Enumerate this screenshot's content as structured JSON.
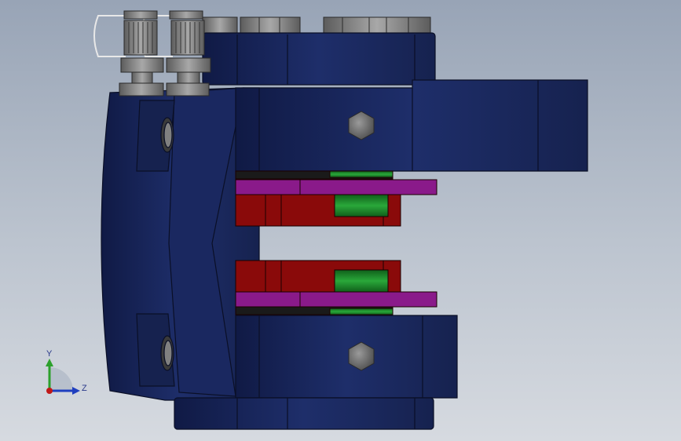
{
  "viewport": {
    "background_top": "#98a4b6",
    "background_bottom": "#d6dae0"
  },
  "model": {
    "body_color": "#1b2a63",
    "body_edge": "#0a0f26",
    "pad_color": "#8a0a0a",
    "shim_color": "#8a1a8a",
    "spring_color": "#1f8a2a",
    "hardware_color": "#8a8a8a"
  },
  "triad": {
    "y_label": "Y",
    "z_label": "Z",
    "y_color": "#2ca02c",
    "z_color": "#1f3fbf",
    "x_color": "#c01818"
  }
}
